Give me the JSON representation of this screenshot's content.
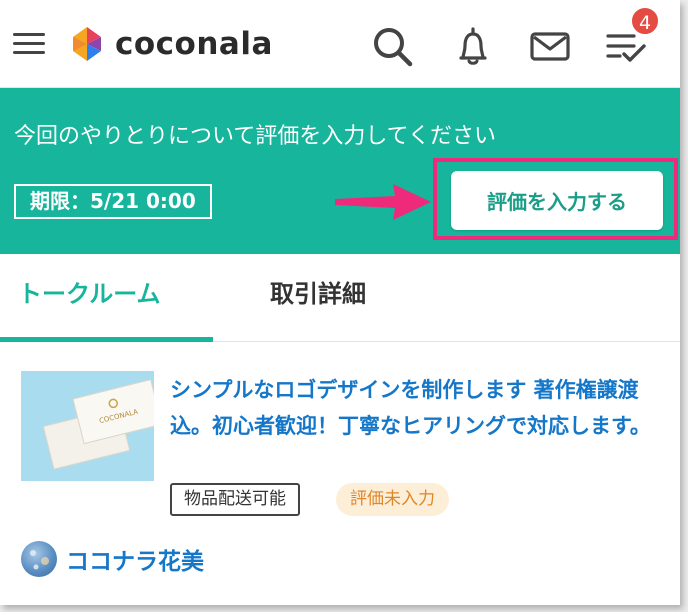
{
  "header": {
    "logo_text": "coconala",
    "notification_count": "4",
    "icons": [
      "menu-icon",
      "coconala-logo-icon",
      "search-icon",
      "bell-icon",
      "mail-icon",
      "checklist-icon"
    ]
  },
  "banner": {
    "message": "今回のやりとりについて評価を入力してください",
    "deadline": "期限：5/21 0:00",
    "rate_button": "評価を入力する",
    "background_color": "#17b59b",
    "highlight_color": "#ee2a7b"
  },
  "tabs": [
    {
      "label": "トークルーム",
      "active": true
    },
    {
      "label": "取引詳細",
      "active": false
    }
  ],
  "service": {
    "title": "シンプルなロゴデザインを制作します 著作権譲渡込。初心者歓迎！丁寧なヒアリングで対応します。",
    "thumbnail_text": "COCONALA",
    "tags": [
      "物品配送可能",
      "評価未入力"
    ]
  },
  "seller": {
    "name": "ココナラ花美"
  }
}
